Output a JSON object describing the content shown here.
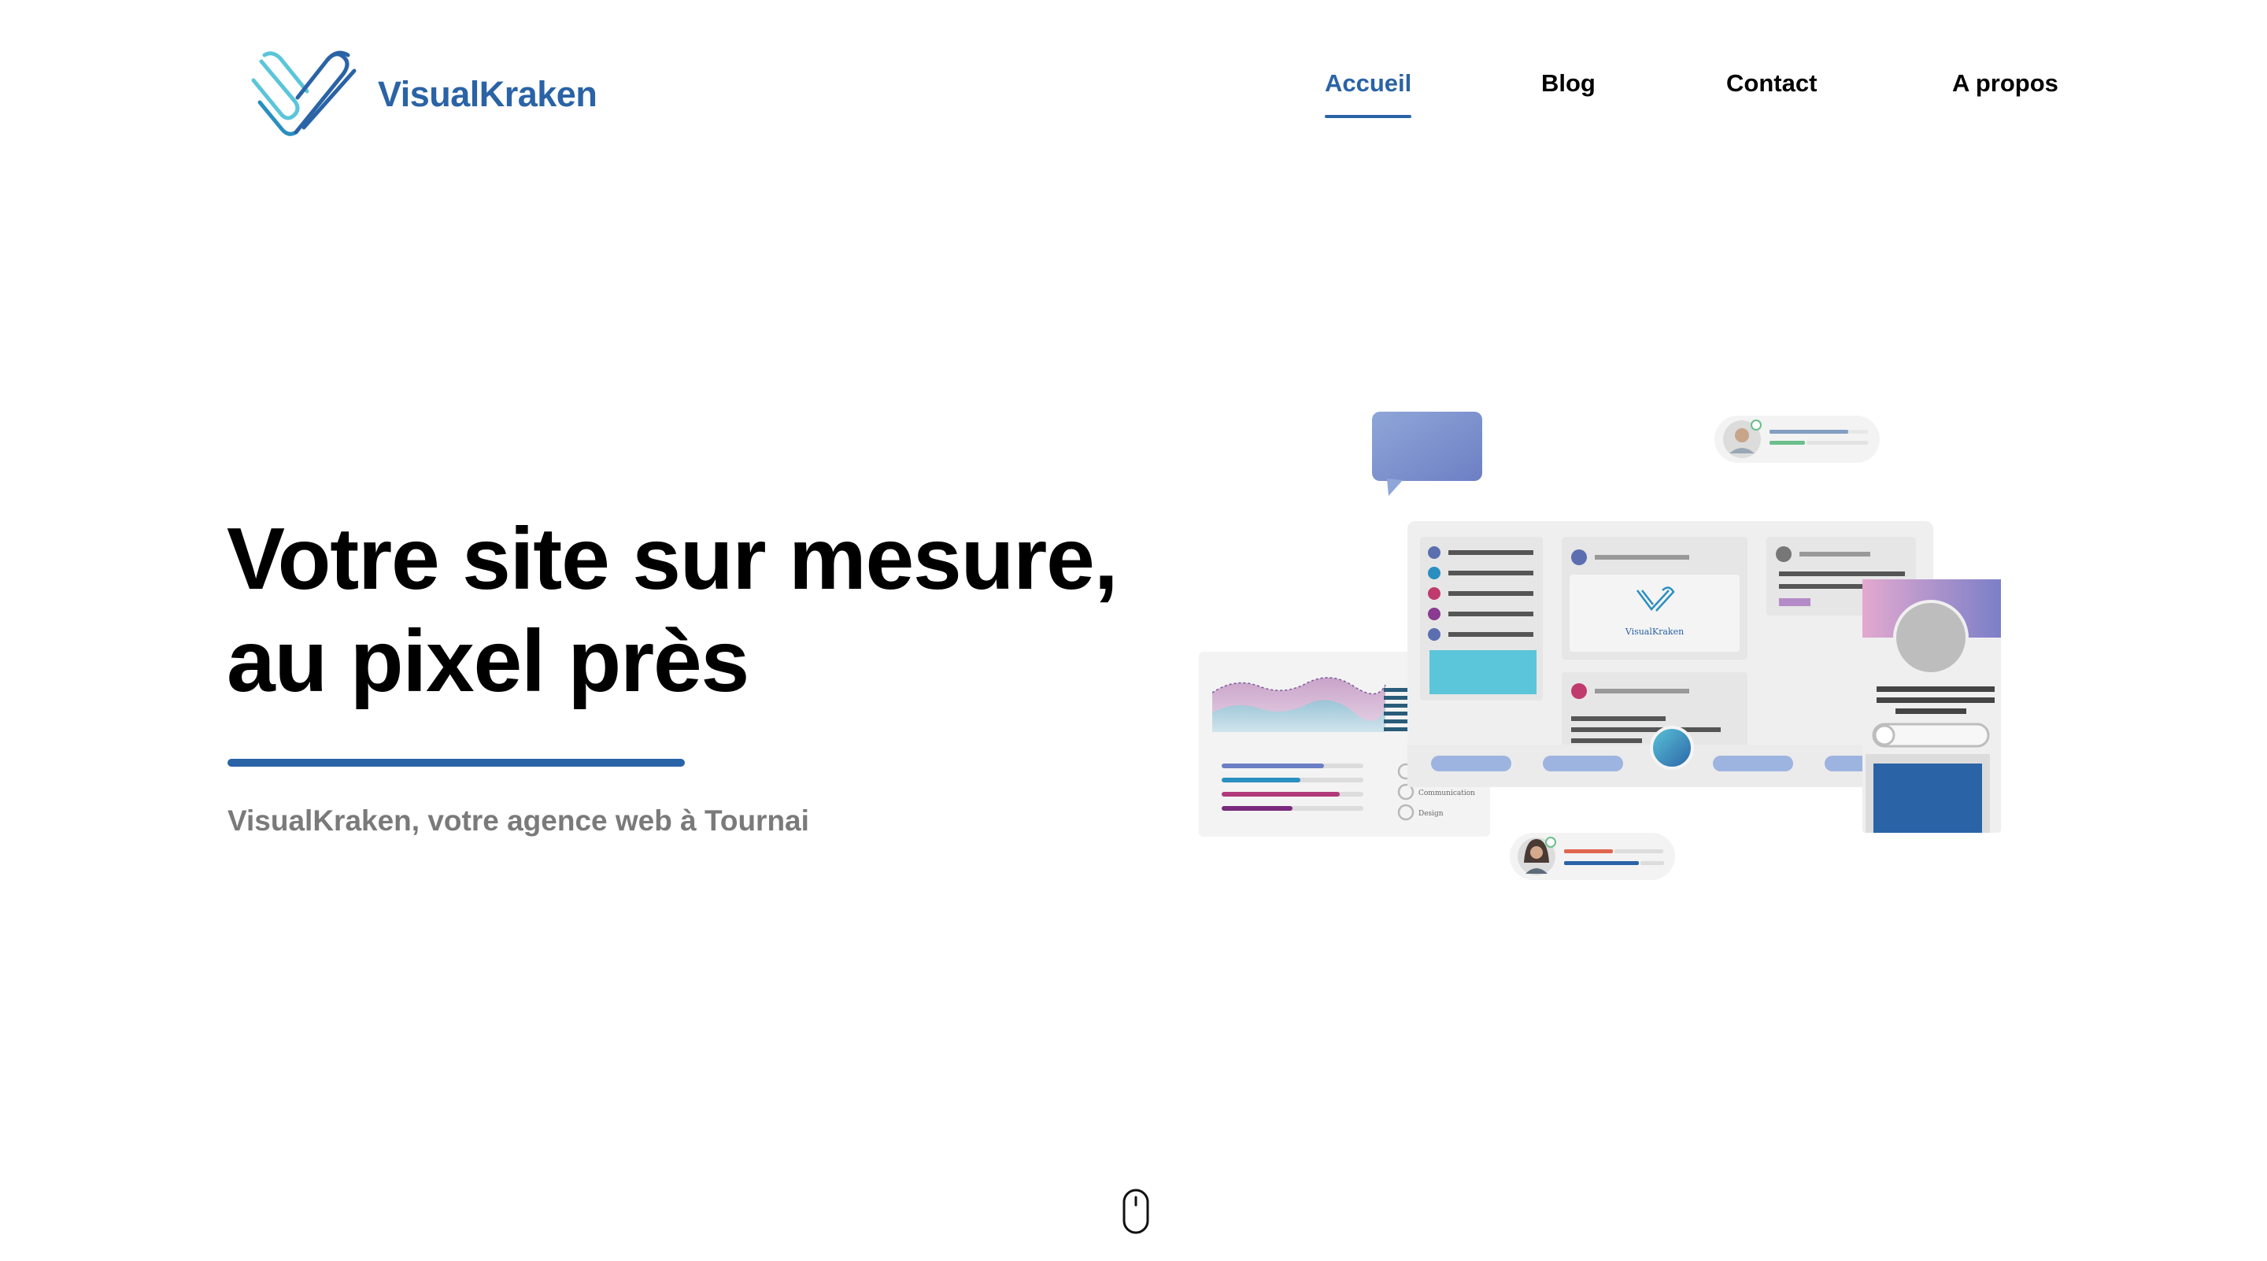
{
  "brand": {
    "name": "VisualKraken",
    "logo_icon": "kraken-v-logo-icon",
    "color": "#2a63a6"
  },
  "nav": {
    "items": [
      {
        "label": "Accueil",
        "active": true
      },
      {
        "label": "Blog",
        "active": false
      },
      {
        "label": "Contact",
        "active": false
      },
      {
        "label": "A propos",
        "active": false
      }
    ]
  },
  "hero": {
    "title_line1": "Votre site sur mesure,",
    "title_line2": "au pixel près",
    "subtitle": "VisualKraken, votre agence web à Tournai"
  },
  "illustration": {
    "logo_text": "VisualKraken",
    "legend": [
      "Communication",
      "Design"
    ]
  },
  "scroll_icon": "mouse-scroll-icon",
  "colors": {
    "accent": "#2a63a6",
    "text": "#000000",
    "subtitle": "#7a7a7a",
    "cyan": "#5bc5d9",
    "purple": "#8a3a8f",
    "magenta": "#c03a6e"
  }
}
